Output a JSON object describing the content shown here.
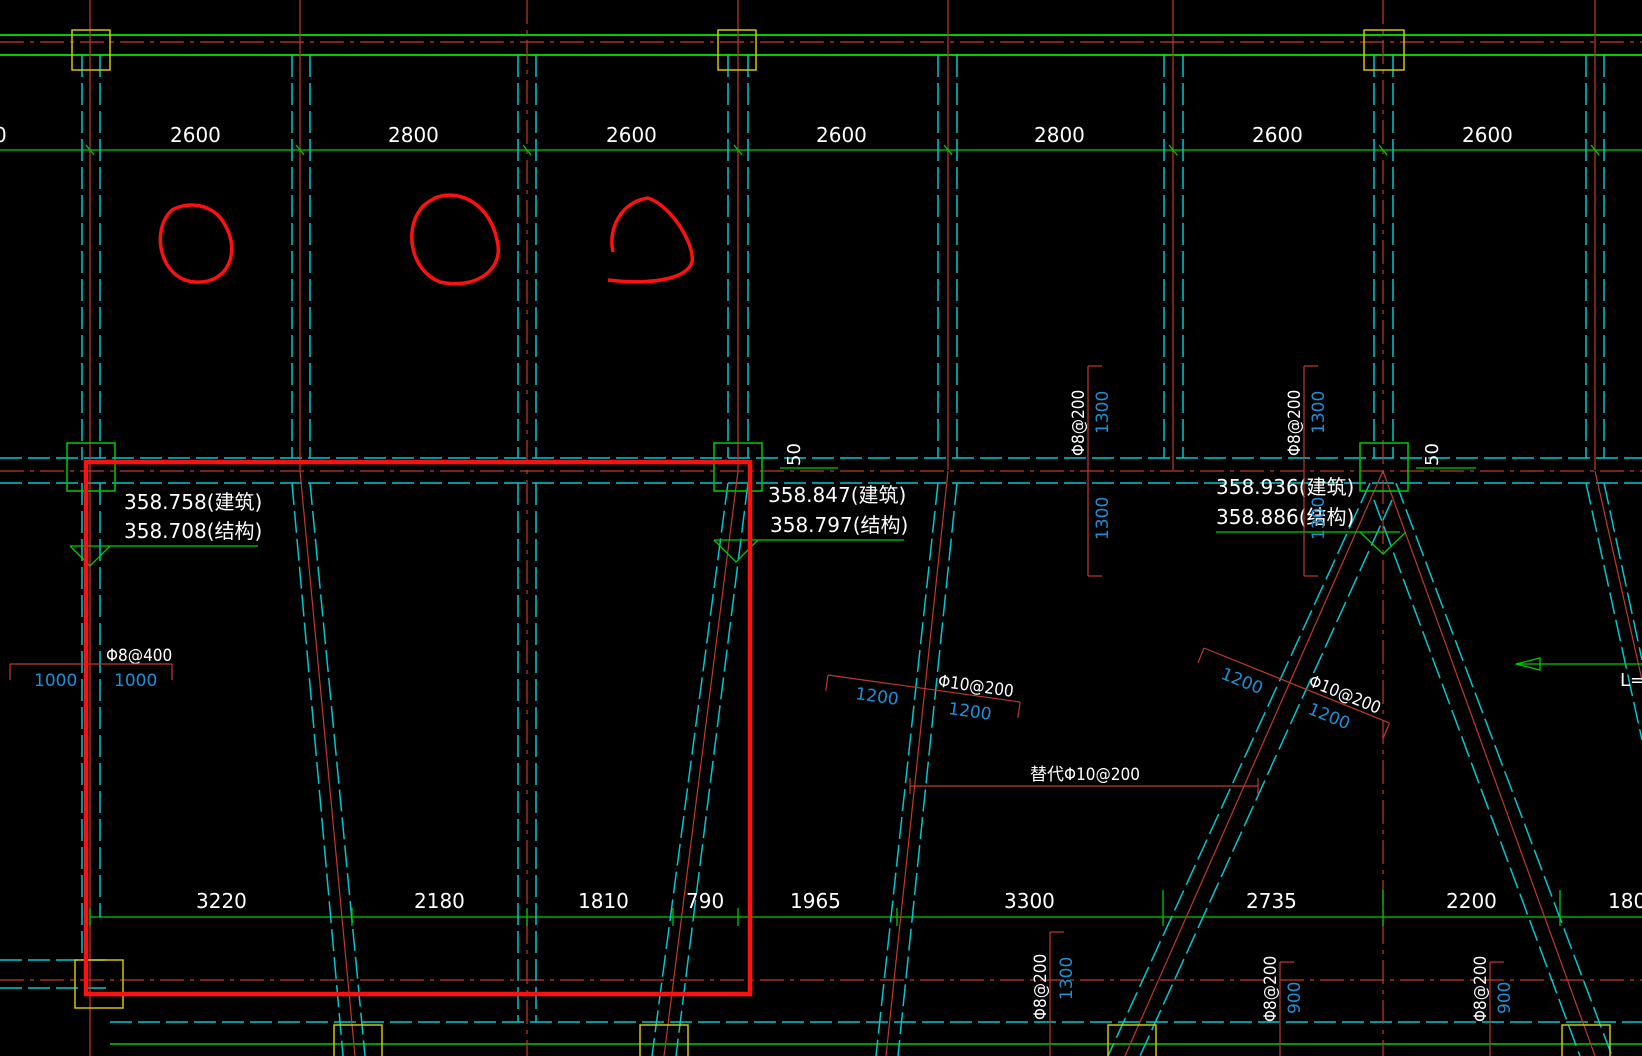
{
  "colors": {
    "background": "#000000",
    "grid_green": "#00cc00",
    "axis_red": "#c0392b",
    "beam_cyan": "#00c8d0",
    "column_yellow": "#d4c400",
    "column_green": "#00cc00",
    "rebar_text_blue": "#1e90d6",
    "markup_red": "#ff1010"
  },
  "top_dimensions": [
    "2600",
    "2800",
    "2600",
    "2600",
    "2800",
    "2600",
    "2600"
  ],
  "bottom_dimensions": [
    "3220",
    "2180",
    "1810",
    "790",
    "1965",
    "3300",
    "2735",
    "2200",
    "180"
  ],
  "left_partial_dim": "0",
  "elevations": [
    {
      "arch": "358.758(建筑)",
      "struct": "358.708(结构)"
    },
    {
      "arch": "358.847(建筑)",
      "struct": "358.797(结构)"
    },
    {
      "arch": "358.936(建筑)",
      "struct": "358.886(结构)"
    }
  ],
  "offset_label": "50",
  "rebar": {
    "left": {
      "spec": "Φ8@400",
      "a": "1000",
      "b": "1000"
    },
    "mid": {
      "spec": "Φ10@200",
      "a": "1200",
      "b": "1200"
    },
    "right": {
      "spec": "Φ10@200",
      "a": "1200",
      "b": "1200"
    },
    "replace": "替代Φ10@200",
    "top_v1": {
      "spec": "Φ8@200",
      "a": "1300",
      "b": "1300"
    },
    "top_v2": {
      "spec": "Φ8@200",
      "a": "1300",
      "b": "1300"
    },
    "bot_v1": {
      "spec": "Φ8@200",
      "a": "1300"
    },
    "bot_v2": {
      "spec": "Φ8@200",
      "a": "900"
    },
    "bot_v3": {
      "spec": "Φ8@200",
      "a": "900"
    }
  },
  "edge_label": "L="
}
